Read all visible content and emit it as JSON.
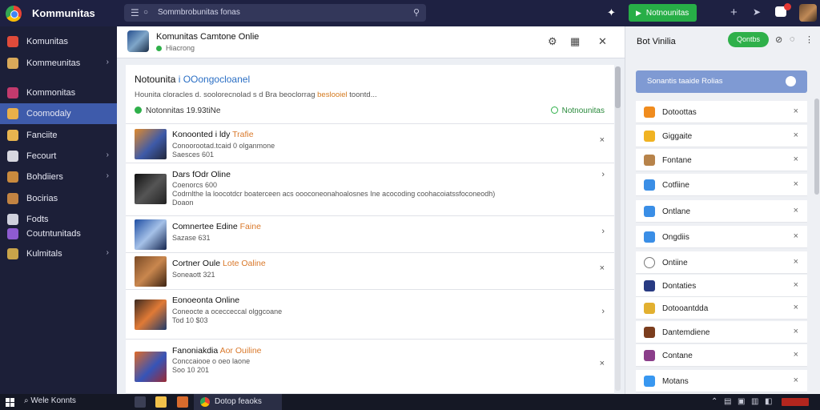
{
  "app": {
    "title": "Kommunitas"
  },
  "search": {
    "text": "Sommbrobunitas fonas"
  },
  "topbar": {
    "join_label": "Notnounitas"
  },
  "sidebar": {
    "items": [
      {
        "label": "Komunitas",
        "icon": "fire-icon",
        "color": "#e04b3a",
        "chevron": false,
        "active": false
      },
      {
        "label": "Kommeunitas",
        "icon": "book-icon",
        "color": "#d9a95a",
        "chevron": true,
        "active": false
      },
      {
        "label": "Kommonitas",
        "icon": "group-icon",
        "color": "#c23a6d",
        "chevron": false,
        "active": false
      },
      {
        "label": "Coomodaly",
        "icon": "avatar-icon",
        "color": "#e9b04a",
        "chevron": false,
        "active": true
      },
      {
        "label": "Fanciite",
        "icon": "folder-icon",
        "color": "#e8b44f",
        "chevron": false,
        "active": false
      },
      {
        "label": "Fecourt",
        "icon": "briefcase-icon",
        "color": "#d7d7e0",
        "chevron": true,
        "active": false
      },
      {
        "label": "Bohdiiers",
        "icon": "wrench-icon",
        "color": "#c98a3e",
        "chevron": true,
        "active": false
      },
      {
        "label": "Bocirias",
        "icon": "tools-icon",
        "color": "#c28342",
        "chevron": false,
        "active": false
      },
      {
        "label": "Fodts",
        "icon": "list-icon",
        "color": "#cfd1dd",
        "chevron": false,
        "active": false
      },
      {
        "label": "Coutntunitads",
        "icon": "community-icon",
        "color": "#8e5bd1",
        "chevron": false,
        "active": false
      },
      {
        "label": "Kulmitals",
        "icon": "tools-icon",
        "color": "#c9a44a",
        "chevron": true,
        "active": false
      }
    ]
  },
  "main": {
    "header": {
      "title": "Komunitas Camtone Onlie",
      "status": "Hiacrong"
    },
    "notice": {
      "title": "Notounita",
      "title_accent": "i OOongocloanel",
      "desc_start": "Hounita cloracles d. soolorecnolad s d Bra beoclorrag",
      "desc_highlight": "beslooiel",
      "desc_end": "toontd...",
      "foot_left": "Notonnitas 19.93tiNe",
      "foot_right": "Notnounitas"
    },
    "rows": [
      {
        "title": "Konoonted i ldy",
        "title_accent": "Trafie",
        "sub": [
          "Conoorootad.tcaid 0 olganmone",
          "Saesces 601"
        ],
        "thumb": "linear-gradient(135deg,#e08a2d,#3e5aa8 55%,#22273b)"
      },
      {
        "title": "Dars fOdr Oline",
        "title_accent": "",
        "sub": [
          "Coenorcs 600",
          "Codrnlthe la loocotdcr boaterceen acs oooconeonahoalosnes Ine acocoding coohacoiatssfoconeodh)",
          "Doaon"
        ],
        "thumb": "linear-gradient(135deg,#111,#555 50%,#222)"
      },
      {
        "title": "Comnertee Edine",
        "title_accent": "Faine",
        "sub": [
          "Sazase 631"
        ],
        "thumb": "linear-gradient(135deg,#1f4ea3,#a5c1e8 50%,#14254f)"
      },
      {
        "title": "Cortner Oule",
        "title_accent": "Lote Oaline",
        "sub": [
          "Soneaott 321"
        ],
        "thumb": "linear-gradient(135deg,#7a4a26,#c9874e 50%,#3d2413)"
      },
      {
        "title": "Eonoeonta Online",
        "title_accent": "",
        "sub": [
          "Coneocte a ocecceccal olggcoane",
          "Tod 10 $03"
        ],
        "thumb": "linear-gradient(135deg,#3c2a20,#e07a36 50%,#203a6a)"
      },
      {
        "title": "Fanoniakdia",
        "title_accent": "Aor Ouiline",
        "sub": [
          "Conccaiooe o oeo laone",
          "Soo 10 201"
        ],
        "thumb": "linear-gradient(135deg,#e06a28,#3654b8 55%,#9b2a34)"
      }
    ]
  },
  "right": {
    "title": "Bot Vinilia",
    "button_label": "Qontbs",
    "search_text": "Sonantis taaide Rolias",
    "items": [
      {
        "label": "Dotoottas",
        "icon": "orange-badge-icon",
        "color": "#f08c1e"
      },
      {
        "label": "Giggaite",
        "icon": "smile-icon",
        "color": "#f0b322"
      },
      {
        "label": "Fontane",
        "icon": "frame-icon",
        "color": "#b7834a"
      },
      {
        "label": "Cotfiine",
        "icon": "check-icon",
        "color": "#3a8ee6"
      },
      {
        "label": "Ontlane",
        "icon": "check-icon",
        "color": "#3a8ee6"
      },
      {
        "label": "Ongdiis",
        "icon": "check-icon",
        "color": "#3a8ee6"
      },
      {
        "label": "Ontiine",
        "icon": "circle-icon",
        "color": "#777777"
      },
      {
        "label": "Dontaties",
        "icon": "grid-icon",
        "color": "#283a82"
      },
      {
        "label": "Dotooantdda",
        "icon": "smile-icon",
        "color": "#e2b030"
      },
      {
        "label": "Dantemdiene",
        "icon": "badge-icon",
        "color": "#7b3d1e"
      },
      {
        "label": "Contane",
        "icon": "puzzle-icon",
        "color": "#8b3e8a"
      },
      {
        "label": "Motans",
        "icon": "bird-icon",
        "color": "#3897f0"
      }
    ]
  },
  "taskbar": {
    "search_text": "Wele Konnts",
    "browser_label": "Dotop feaoks"
  }
}
